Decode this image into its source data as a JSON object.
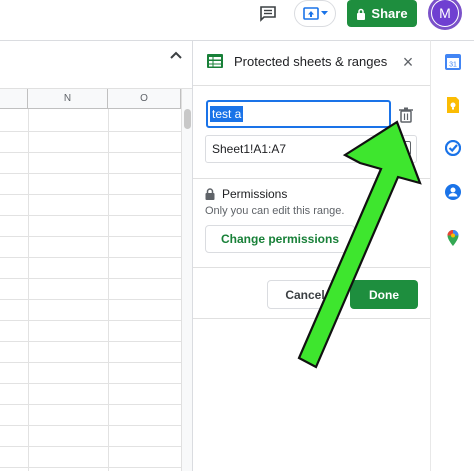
{
  "topbar": {
    "share_label": "Share",
    "avatar_initial": "M"
  },
  "sheet": {
    "columns": [
      "N",
      "O"
    ]
  },
  "panel": {
    "title": "Protected sheets & ranges",
    "name_value": "test a",
    "range_value": "Sheet1!A1:A7",
    "permissions_title": "Permissions",
    "permissions_desc": "Only you can edit this range.",
    "change_permissions_label": "Change permissions",
    "cancel_label": "Cancel",
    "done_label": "Done"
  },
  "rail": {
    "icons": [
      "calendar-icon",
      "keep-icon",
      "tasks-icon",
      "contacts-icon",
      "maps-icon"
    ]
  },
  "colors": {
    "share_green": "#1e8e3e",
    "selection_blue": "#1a73e8",
    "annotation_arrow": "#3ee62e"
  }
}
